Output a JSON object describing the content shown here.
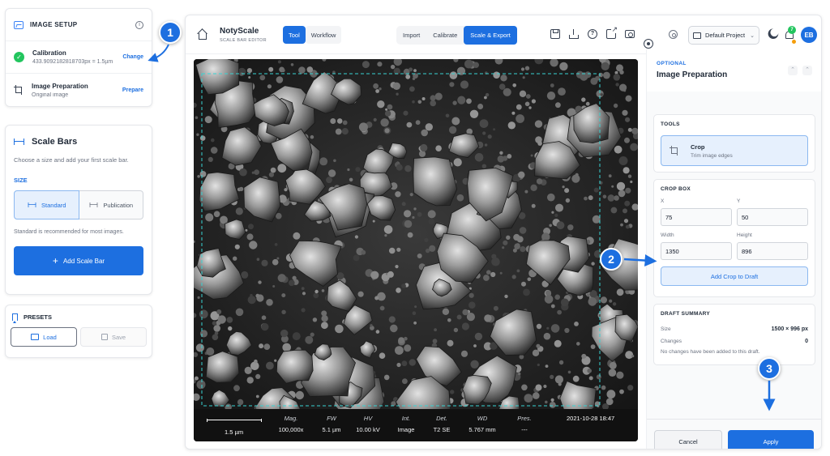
{
  "left_panel": {
    "image_setup": {
      "title": "IMAGE SETUP",
      "info_icon": "info-icon",
      "calibration": {
        "label": "Calibration",
        "value": "433.9092182818703px = 1.5µm",
        "action": "Change",
        "status_icon": "check-circle-icon"
      },
      "image_preparation": {
        "label": "Image Preparation",
        "value": "Original image",
        "action": "Prepare"
      }
    },
    "scale_bars": {
      "title": "Scale Bars",
      "description": "Choose a size and add your first scale bar.",
      "size_label": "SIZE",
      "options": [
        "Standard",
        "Publication"
      ],
      "selected": "Standard",
      "hint": "Standard is recommended for most images.",
      "add_label": "Add Scale Bar"
    },
    "presets": {
      "title": "PRESETS",
      "load_label": "Load",
      "save_label": "Save"
    }
  },
  "topbar": {
    "app_name": "NotyScale",
    "app_subtitle": "SCALE BAR EDITOR",
    "modes": [
      "Tool",
      "Workflow"
    ],
    "active_mode": "Tool",
    "steps": [
      "Import",
      "Calibrate",
      "Scale & Export"
    ],
    "active_step": "Scale & Export",
    "project_label": "Default Project",
    "notification_count": "7",
    "avatar_initials": "EB"
  },
  "canvas": {
    "databar": {
      "scale_label": "1.5 µm",
      "columns": [
        {
          "header": "Mag.",
          "value": "100,000x"
        },
        {
          "header": "FW",
          "value": "5.1 µm"
        },
        {
          "header": "HV",
          "value": "10.00 kV"
        },
        {
          "header": "Int.",
          "value": "Image"
        },
        {
          "header": "Det.",
          "value": "T2 SE"
        },
        {
          "header": "WD",
          "value": "5.767 mm"
        },
        {
          "header": "Pres.",
          "value": "---"
        }
      ],
      "datetime": "2021-10-28 18:47"
    }
  },
  "right_panel": {
    "optional_label": "OPTIONAL",
    "title": "Image Preparation",
    "tools": {
      "title": "TOOLS",
      "crop_label": "Crop",
      "crop_desc": "Trim image edges"
    },
    "crop_box": {
      "title": "CROP BOX",
      "x_label": "X",
      "x_value": "75",
      "y_label": "Y",
      "y_value": "50",
      "width_label": "Width",
      "width_value": "1350",
      "height_label": "Height",
      "height_value": "896",
      "add_label": "Add Crop to Draft"
    },
    "draft_summary": {
      "title": "DRAFT SUMMARY",
      "size_label": "Size",
      "size_value": "1500 × 996 px",
      "changes_label": "Changes",
      "changes_value": "0",
      "note": "No changes have been added to this draft."
    },
    "cancel_label": "Cancel",
    "apply_label": "Apply"
  },
  "callouts": [
    "1",
    "2",
    "3"
  ],
  "colors": {
    "accent": "#1d6fe0",
    "success": "#22c55e",
    "crop_guide": "#38d3d3"
  }
}
